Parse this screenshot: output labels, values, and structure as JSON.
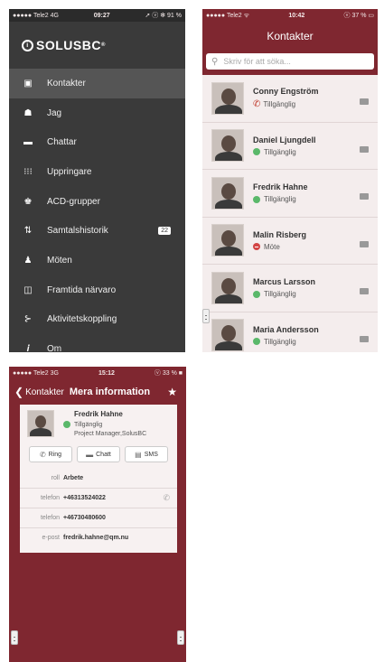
{
  "phone1": {
    "status": {
      "carrier": "●●●●● Tele2  4G",
      "time": "09:27",
      "right": "➚ ⓥ ✻ 91 %"
    },
    "logo": "SOLUSBC",
    "menu": [
      {
        "icon": "contacts-icon",
        "glyph": "▣",
        "label": "Kontakter"
      },
      {
        "icon": "person-icon",
        "glyph": "☗",
        "label": "Jag"
      },
      {
        "icon": "chat-icon",
        "glyph": "▬",
        "label": "Chattar"
      },
      {
        "icon": "dialpad-icon",
        "glyph": "⁝⁝⁝",
        "label": "Uppringare"
      },
      {
        "icon": "acd-group-icon",
        "glyph": "♚",
        "label": "ACD-grupper"
      },
      {
        "icon": "call-history-icon",
        "glyph": "⇅",
        "label": "Samtalshistorik",
        "badge": "22"
      },
      {
        "icon": "meetings-icon",
        "glyph": "♟",
        "label": "Möten"
      },
      {
        "icon": "future-presence-icon",
        "glyph": "◫",
        "label": "Framtida närvaro"
      },
      {
        "icon": "activity-link-icon",
        "glyph": "⊱",
        "label": "Aktivitetskoppling"
      },
      {
        "icon": "info-icon",
        "glyph": "𝒊",
        "label": "Om"
      }
    ]
  },
  "phone2": {
    "status": {
      "carrier": "●●●●● Tele2 ᯤ",
      "time": "10:42",
      "right": "ⓥ 37 % ▭"
    },
    "title": "Kontakter",
    "search_placeholder": "Skriv för att söka...",
    "contacts": [
      {
        "name": "Conny Engström",
        "status": "Tillgänglig",
        "indicator": "phone",
        "color": "#c0392b"
      },
      {
        "name": "Daniel Ljungdell",
        "status": "Tillgänglig",
        "indicator": "green"
      },
      {
        "name": "Fredrik Hahne",
        "status": "Tillgänglig",
        "indicator": "green"
      },
      {
        "name": "Malin Risberg",
        "status": "Möte",
        "indicator": "red"
      },
      {
        "name": "Marcus Larsson",
        "status": "Tillgänglig",
        "indicator": "green"
      },
      {
        "name": "Maria Andersson",
        "status": "Tillgänglig",
        "indicator": "green"
      }
    ]
  },
  "phone3": {
    "status": {
      "carrier": "●●●●● Tele2  3G",
      "time": "15:12",
      "right": "ⓥ 33 % ■"
    },
    "back_label": "Kontakter",
    "title": "Mera information",
    "profile": {
      "name": "Fredrik Hahne",
      "status": "Tillgänglig",
      "title": "Project Manager,SolusBC"
    },
    "buttons": {
      "call": "Ring",
      "chat": "Chatt",
      "sms": "SMS"
    },
    "rows": [
      {
        "label": "roll",
        "value": "Arbete"
      },
      {
        "label": "telefon",
        "value": "+46313524022"
      },
      {
        "label": "telefon",
        "value": "+46730480600"
      },
      {
        "label": "e-post",
        "value": "fredrik.hahne@qm.nu"
      }
    ]
  }
}
